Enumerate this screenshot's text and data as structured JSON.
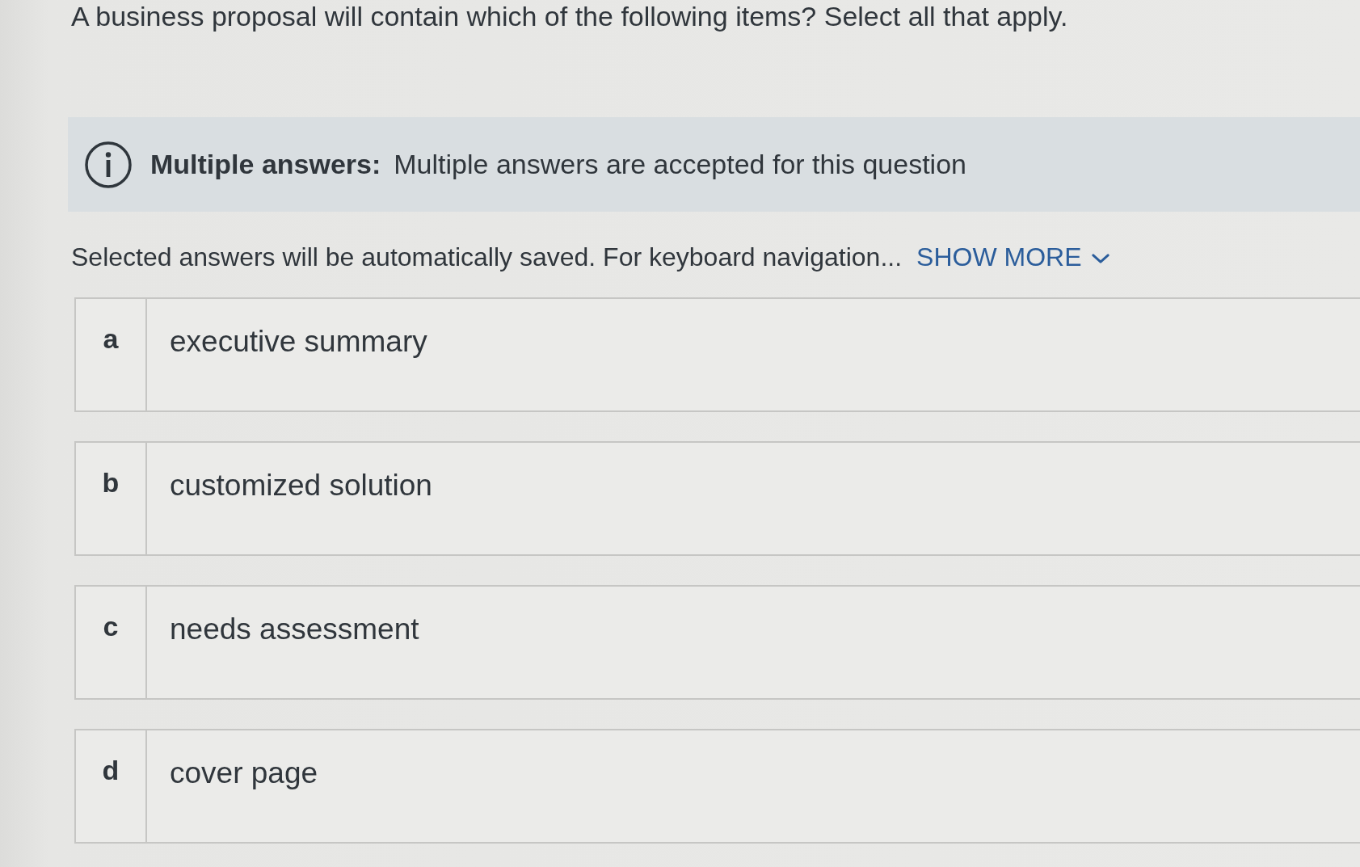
{
  "question": {
    "text": "A business proposal will contain which of the following items? Select all that apply."
  },
  "notice": {
    "label": "Multiple answers:",
    "message": "Multiple answers are accepted for this question"
  },
  "instructions": {
    "text": "Selected answers will be automatically saved. For keyboard navigation...",
    "link": "SHOW MORE"
  },
  "options": [
    {
      "letter": "a",
      "text": "executive summary",
      "selected": false
    },
    {
      "letter": "b",
      "text": "customized solution",
      "selected": false
    },
    {
      "letter": "c",
      "text": "needs assessment",
      "selected": false
    },
    {
      "letter": "d",
      "text": "cover page",
      "selected": false
    }
  ]
}
